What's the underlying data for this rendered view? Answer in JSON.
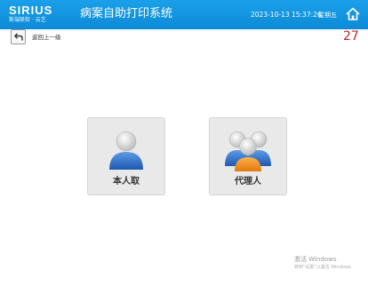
{
  "header": {
    "logo_text": "SIRIUS",
    "logo_sub": "斯瑞联软 · 云艺",
    "app_title": "病案自助打印系统",
    "datetime": "2023-10-13 15:37:26",
    "weekday": "星期五",
    "home_icon": "home-icon"
  },
  "nav": {
    "back_label": "返回上一级",
    "back_icon": "back-arrow-icon"
  },
  "countdown": "27",
  "options": [
    {
      "label": "本人取",
      "icon": "single-user-icon"
    },
    {
      "label": "代理人",
      "icon": "user-group-icon"
    }
  ],
  "watermark": {
    "title": "激活 Windows",
    "subtitle": "转到\"设置\"以激活 Windows。"
  },
  "colors": {
    "header_bg": "#0d8ad6",
    "countdown": "#cc1f1f",
    "card_bg": "#e9e9e9",
    "user_blue": "#2f6fc4",
    "user_orange": "#f08a1c"
  }
}
